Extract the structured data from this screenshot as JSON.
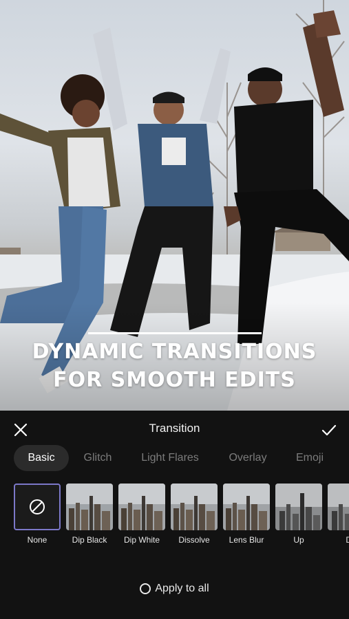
{
  "hero": {
    "headline_line1": "DYNAMIC TRANSITIONS",
    "headline_line2": "FOR SMOOTH EDITS"
  },
  "panel": {
    "title": "Transition",
    "close_icon": "close-icon",
    "confirm_icon": "check-icon",
    "tabs": [
      {
        "label": "Basic",
        "active": true
      },
      {
        "label": "Glitch",
        "active": false
      },
      {
        "label": "Light Flares",
        "active": false
      },
      {
        "label": "Overlay",
        "active": false
      },
      {
        "label": "Emoji",
        "active": false
      }
    ],
    "transitions": [
      {
        "label": "None",
        "icon": "no-effect-icon",
        "selected": true
      },
      {
        "label": "Dip Black",
        "selected": false
      },
      {
        "label": "Dip White",
        "selected": false
      },
      {
        "label": "Dissolve",
        "selected": false
      },
      {
        "label": "Lens Blur",
        "selected": false
      },
      {
        "label": "Up",
        "selected": false
      },
      {
        "label": "Do",
        "selected": false
      }
    ],
    "apply_to_all": "Apply to all"
  },
  "colors": {
    "panel_bg": "#121212",
    "active_tab_bg": "#2b2b2b",
    "selected_border": "#7c78c9",
    "inactive_tab_text": "#7c7c7c"
  }
}
